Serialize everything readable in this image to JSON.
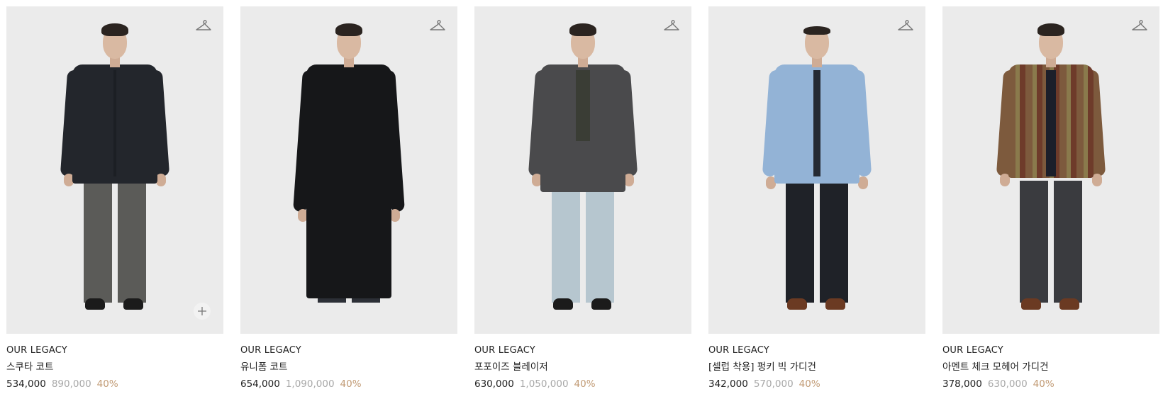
{
  "products": [
    {
      "brand": "OUR LEGACY",
      "name": "스쿠타 코트",
      "price": "534,000",
      "original_price": "890,000",
      "discount": "40%",
      "icons": [
        "hanger-icon",
        "plus-icon"
      ],
      "colors": {
        "top": "#23262c",
        "legs": "#5b5b58",
        "shoes": "#1b1b1b"
      }
    },
    {
      "brand": "OUR LEGACY",
      "name": "유니폼 코트",
      "price": "654,000",
      "original_price": "1,090,000",
      "discount": "40%",
      "icons": [
        "hanger-icon"
      ],
      "colors": {
        "top": "#161719",
        "legs": "#2c2f36",
        "shoes": "#1b1b1b"
      }
    },
    {
      "brand": "OUR LEGACY",
      "name": "포포이즈 블레이저",
      "price": "630,000",
      "original_price": "1,050,000",
      "discount": "40%",
      "icons": [
        "hanger-icon"
      ],
      "colors": {
        "top": "#4a4a4c",
        "legs": "#b6c6cf",
        "shoes": "#1b1b1b"
      }
    },
    {
      "brand": "OUR LEGACY",
      "name": "[셀럽 착용] 펑키 빅 가디건",
      "price": "342,000",
      "original_price": "570,000",
      "discount": "40%",
      "icons": [
        "hanger-icon"
      ],
      "colors": {
        "top": "#93b3d6",
        "legs": "#1f2228",
        "shoes": "#6b3a22"
      }
    },
    {
      "brand": "OUR LEGACY",
      "name": "아멘트 체크 모헤어 가디건",
      "price": "378,000",
      "original_price": "630,000",
      "discount": "40%",
      "icons": [
        "hanger-icon"
      ],
      "colors": {
        "top": "#7d5a3d",
        "legs": "#3a3b3f",
        "shoes": "#6b3a22"
      }
    }
  ]
}
